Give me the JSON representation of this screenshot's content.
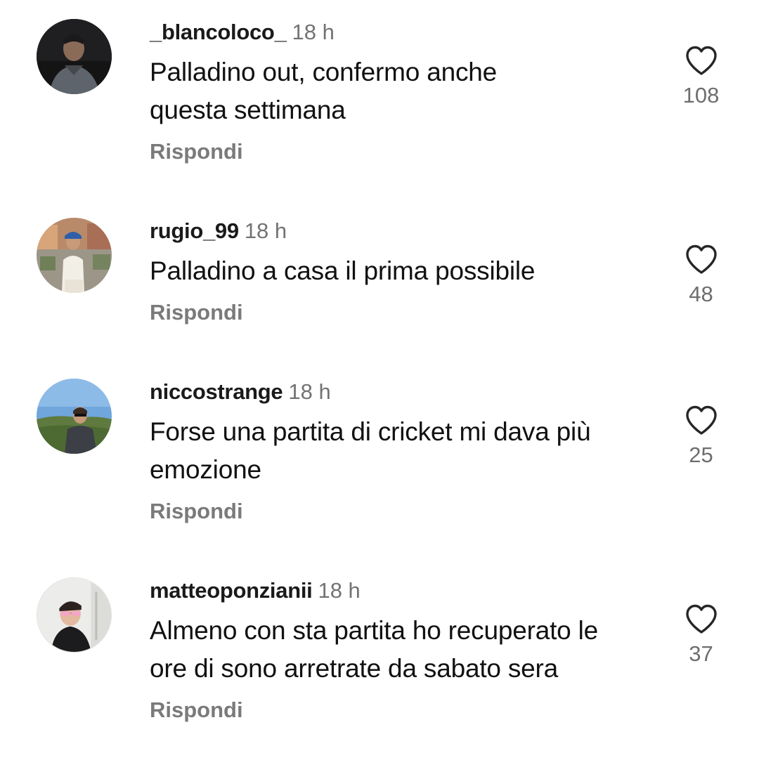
{
  "comments": [
    {
      "username": "_blancoloco_",
      "time": "18 h",
      "text": "Palladino out, confermo anche questa settimana",
      "reply_label": "Rispondi",
      "likes": "108",
      "avatar_icon": "profile-photo"
    },
    {
      "username": "rugio_99",
      "time": "18 h",
      "text": "Palladino a casa il prima possibile",
      "reply_label": "Rispondi",
      "likes": "48",
      "avatar_icon": "profile-photo"
    },
    {
      "username": "niccostrange",
      "time": "18 h",
      "text": "Forse una partita di cricket mi dava più emozione",
      "reply_label": "Rispondi",
      "likes": "25",
      "avatar_icon": "profile-photo"
    },
    {
      "username": "matteoponzianii",
      "time": "18 h",
      "text": "Almeno con sta partita ho recuperato le ore di sono arretrate da sabato sera",
      "reply_label": "Rispondi",
      "likes": "37",
      "avatar_icon": "profile-photo"
    }
  ],
  "colors": {
    "background": "#ffffff",
    "username": "#1a1a1a",
    "secondary_text": "#737373",
    "heart_outline": "#262626"
  },
  "icons": {
    "like": "heart-outline-icon"
  }
}
